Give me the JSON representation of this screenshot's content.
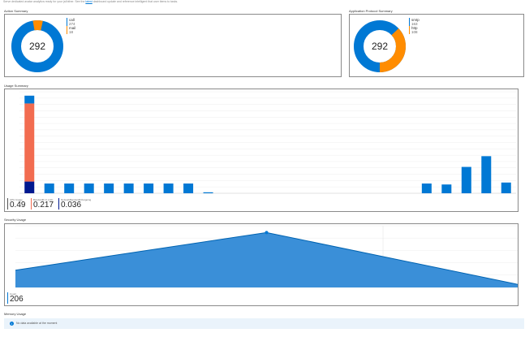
{
  "header": {
    "note": "Serve dedicated avatar analytics ready for your jsf/other. See the",
    "link": "latest",
    "note_end": "dashboard update and reference intelligent that user items to tasks."
  },
  "action_summary": {
    "title": "Action Summary",
    "total": "292",
    "legend": [
      {
        "label": "call",
        "value": "274"
      },
      {
        "label": "mail",
        "value": "18"
      }
    ],
    "colors": {
      "primary": "#0078d4",
      "secondary": "#ff8c00"
    }
  },
  "app_protocol_summary": {
    "title": "Application Protocol Summary",
    "total": "292",
    "legend": [
      {
        "label": "smtp",
        "value": "163"
      },
      {
        "label": "http",
        "value": "108"
      }
    ]
  },
  "usage_summary": {
    "title": "Usage Summary",
    "metrics": [
      {
        "label": "CPU Usage",
        "value": "0.49"
      },
      {
        "label": "Bandwidth In (mb)",
        "value": "0.217"
      },
      {
        "label": "NetworkBandwidthOutgoing",
        "value": "0.036"
      }
    ],
    "chart_data": {
      "type": "bar",
      "series_colors": [
        "#0078d4",
        "#00188f",
        "#f26c50"
      ],
      "bars": [
        {
          "total": 1.0,
          "segments": [
            {
              "color": "#00188f",
              "value": 0.12
            },
            {
              "color": "#f26c50",
              "value": 0.8
            },
            {
              "color": "#0078d4",
              "value": 0.08
            }
          ]
        },
        {
          "total": 0.1
        },
        {
          "total": 0.1
        },
        {
          "total": 0.1
        },
        {
          "total": 0.1
        },
        {
          "total": 0.1
        },
        {
          "total": 0.1
        },
        {
          "total": 0.1
        },
        {
          "total": 0.1
        },
        {
          "total": 0.01
        },
        {
          "total": 0
        },
        {
          "total": 0
        },
        {
          "total": 0
        },
        {
          "total": 0
        },
        {
          "total": 0
        },
        {
          "total": 0
        },
        {
          "total": 0
        },
        {
          "total": 0
        },
        {
          "total": 0
        },
        {
          "total": 0
        },
        {
          "total": 0.1
        },
        {
          "total": 0.09
        },
        {
          "total": 0.27
        },
        {
          "total": 0.38
        },
        {
          "total": 0.11
        }
      ],
      "ylim": [
        0,
        1.04
      ]
    }
  },
  "security_usage": {
    "title": "Security Usage",
    "metric": {
      "label": "Count",
      "value": "206"
    },
    "chart_data": {
      "type": "area",
      "values": [
        0.28,
        0.89,
        0.05
      ],
      "ylim": [
        0,
        1
      ]
    }
  },
  "memory_usage": {
    "title": "Memory Usage",
    "info": "No data available at the moment"
  }
}
